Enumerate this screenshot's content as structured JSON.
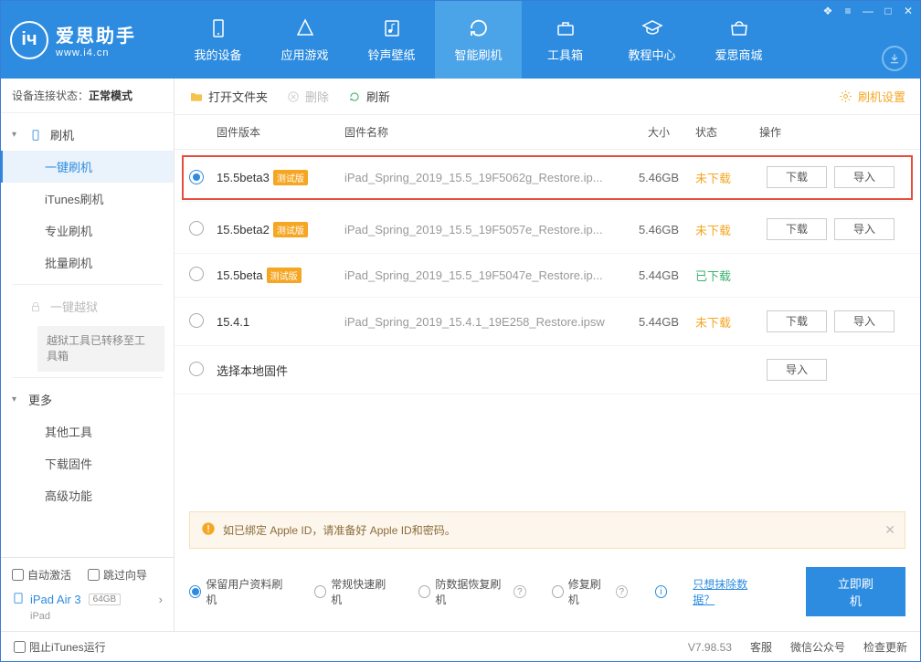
{
  "app": {
    "title": "爱思助手",
    "subtitle": "www.i4.cn"
  },
  "nav": {
    "items": [
      {
        "label": "我的设备"
      },
      {
        "label": "应用游戏"
      },
      {
        "label": "铃声壁纸"
      },
      {
        "label": "智能刷机"
      },
      {
        "label": "工具箱"
      },
      {
        "label": "教程中心"
      },
      {
        "label": "爱思商城"
      }
    ]
  },
  "sidebar": {
    "conn_label": "设备连接状态：",
    "conn_value": "正常模式",
    "group_flash": "刷机",
    "flash_items": [
      "一键刷机",
      "iTunes刷机",
      "专业刷机",
      "批量刷机"
    ],
    "group_jb": "一键越狱",
    "jb_note": "越狱工具已转移至工具箱",
    "group_more": "更多",
    "more_items": [
      "其他工具",
      "下载固件",
      "高级功能"
    ],
    "auto_activate": "自动激活",
    "skip_guide": "跳过向导",
    "device_name": "iPad Air 3",
    "device_cap": "64GB",
    "device_type": "iPad"
  },
  "toolbar": {
    "open": "打开文件夹",
    "delete": "删除",
    "refresh": "刷新",
    "settings": "刷机设置"
  },
  "table": {
    "h_version": "固件版本",
    "h_name": "固件名称",
    "h_size": "大小",
    "h_status": "状态",
    "h_action": "操作",
    "beta_tag": "测试版",
    "btn_download": "下载",
    "btn_import": "导入",
    "rows": [
      {
        "ver": "15.5beta3",
        "beta": true,
        "name": "iPad_Spring_2019_15.5_19F5062g_Restore.ip...",
        "size": "5.46GB",
        "status": "未下载",
        "status_cls": "st-notdl",
        "dl": true
      },
      {
        "ver": "15.5beta2",
        "beta": true,
        "name": "iPad_Spring_2019_15.5_19F5057e_Restore.ip...",
        "size": "5.46GB",
        "status": "未下载",
        "status_cls": "st-notdl",
        "dl": true
      },
      {
        "ver": "15.5beta",
        "beta": true,
        "name": "iPad_Spring_2019_15.5_19F5047e_Restore.ip...",
        "size": "5.44GB",
        "status": "已下载",
        "status_cls": "st-dl",
        "dl": false
      },
      {
        "ver": "15.4.1",
        "beta": false,
        "name": "iPad_Spring_2019_15.4.1_19E258_Restore.ipsw",
        "size": "5.44GB",
        "status": "未下载",
        "status_cls": "st-notdl",
        "dl": true
      }
    ],
    "local_row": "选择本地固件"
  },
  "notice": "如已绑定 Apple ID，请准备好 Apple ID和密码。",
  "flash_opts": {
    "keep": "保留用户资料刷机",
    "normal": "常规快速刷机",
    "antiloss": "防数据恢复刷机",
    "repair": "修复刷机",
    "erase_link": "只想抹除数据？",
    "flash_btn": "立即刷机"
  },
  "footer": {
    "block_itunes": "阻止iTunes运行",
    "version": "V7.98.53",
    "links": [
      "客服",
      "微信公众号",
      "检查更新"
    ]
  }
}
